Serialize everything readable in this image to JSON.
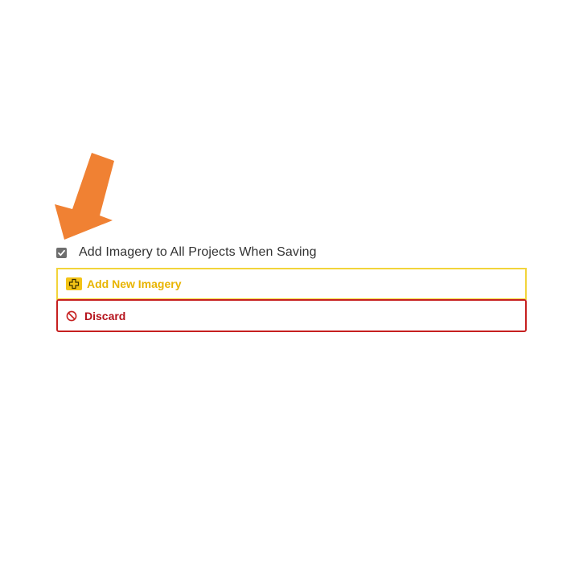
{
  "options": {
    "add_to_all_projects_label": "Add Imagery to All Projects When Saving",
    "add_to_all_projects_checked": true
  },
  "buttons": {
    "add_new_imagery_label": "Add New Imagery",
    "discard_label": "Discard"
  },
  "icons": {
    "pointer": "arrow-down-left-icon",
    "add": "plus-icon",
    "discard": "ban-icon"
  },
  "colors": {
    "arrow": "#f08133",
    "add_accent": "#f2d43a",
    "add_text": "#e8b400",
    "discard_accent": "#c62020",
    "checkbox": "#6e6e6e"
  }
}
